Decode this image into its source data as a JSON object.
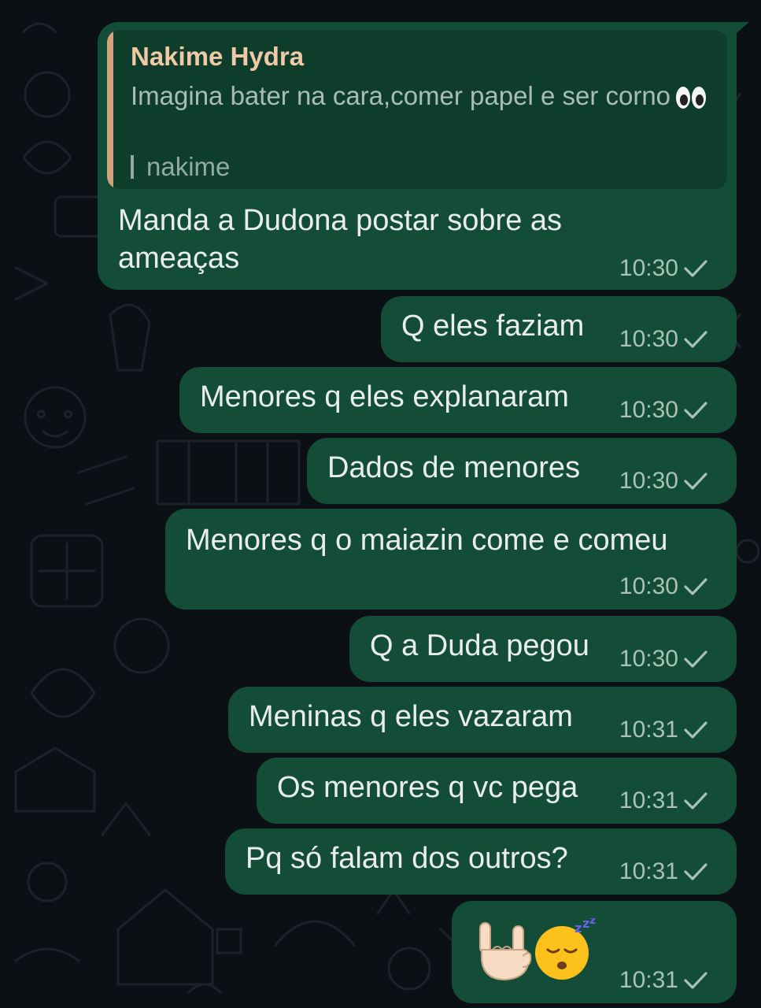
{
  "colors": {
    "background": "#0b1014",
    "bubble_outgoing": "#144d37",
    "quote_background": "#0f3d2c",
    "quote_accent": "#d3a37d",
    "quote_author": "#f0c9a6",
    "timestamp": "#a9c2b6",
    "text": "#e9edef"
  },
  "quoted": {
    "author": "Nakime Hydra",
    "text": "Imagina bater na cara,comer papel e ser corno",
    "text_emoji": "eyes-emoji",
    "sub": "nakime"
  },
  "messages": [
    {
      "text": "Manda a Dudona postar sobre as ameaças",
      "time": "10:30",
      "status": "sent-check-icon"
    },
    {
      "text": "Q eles faziam",
      "time": "10:30",
      "status": "sent-check-icon"
    },
    {
      "text": "Menores q eles explanaram",
      "time": "10:30",
      "status": "sent-check-icon"
    },
    {
      "text": "Dados de menores",
      "time": "10:30",
      "status": "sent-check-icon"
    },
    {
      "text": "Menores q o maiazin come e comeu",
      "time": "10:30",
      "status": "sent-check-icon"
    },
    {
      "text": "Q a Duda pegou",
      "time": "10:30",
      "status": "sent-check-icon"
    },
    {
      "text": "Meninas q eles vazaram",
      "time": "10:31",
      "status": "sent-check-icon"
    },
    {
      "text": "Os menores q vc pega",
      "time": "10:31",
      "status": "sent-check-icon"
    },
    {
      "text": "Pq só falam dos outros?",
      "time": "10:31",
      "status": "sent-check-icon"
    },
    {
      "emojis": [
        "sign-of-horns-emoji",
        "sleeping-face-emoji"
      ],
      "time": "10:31",
      "status": "sent-check-icon"
    }
  ]
}
